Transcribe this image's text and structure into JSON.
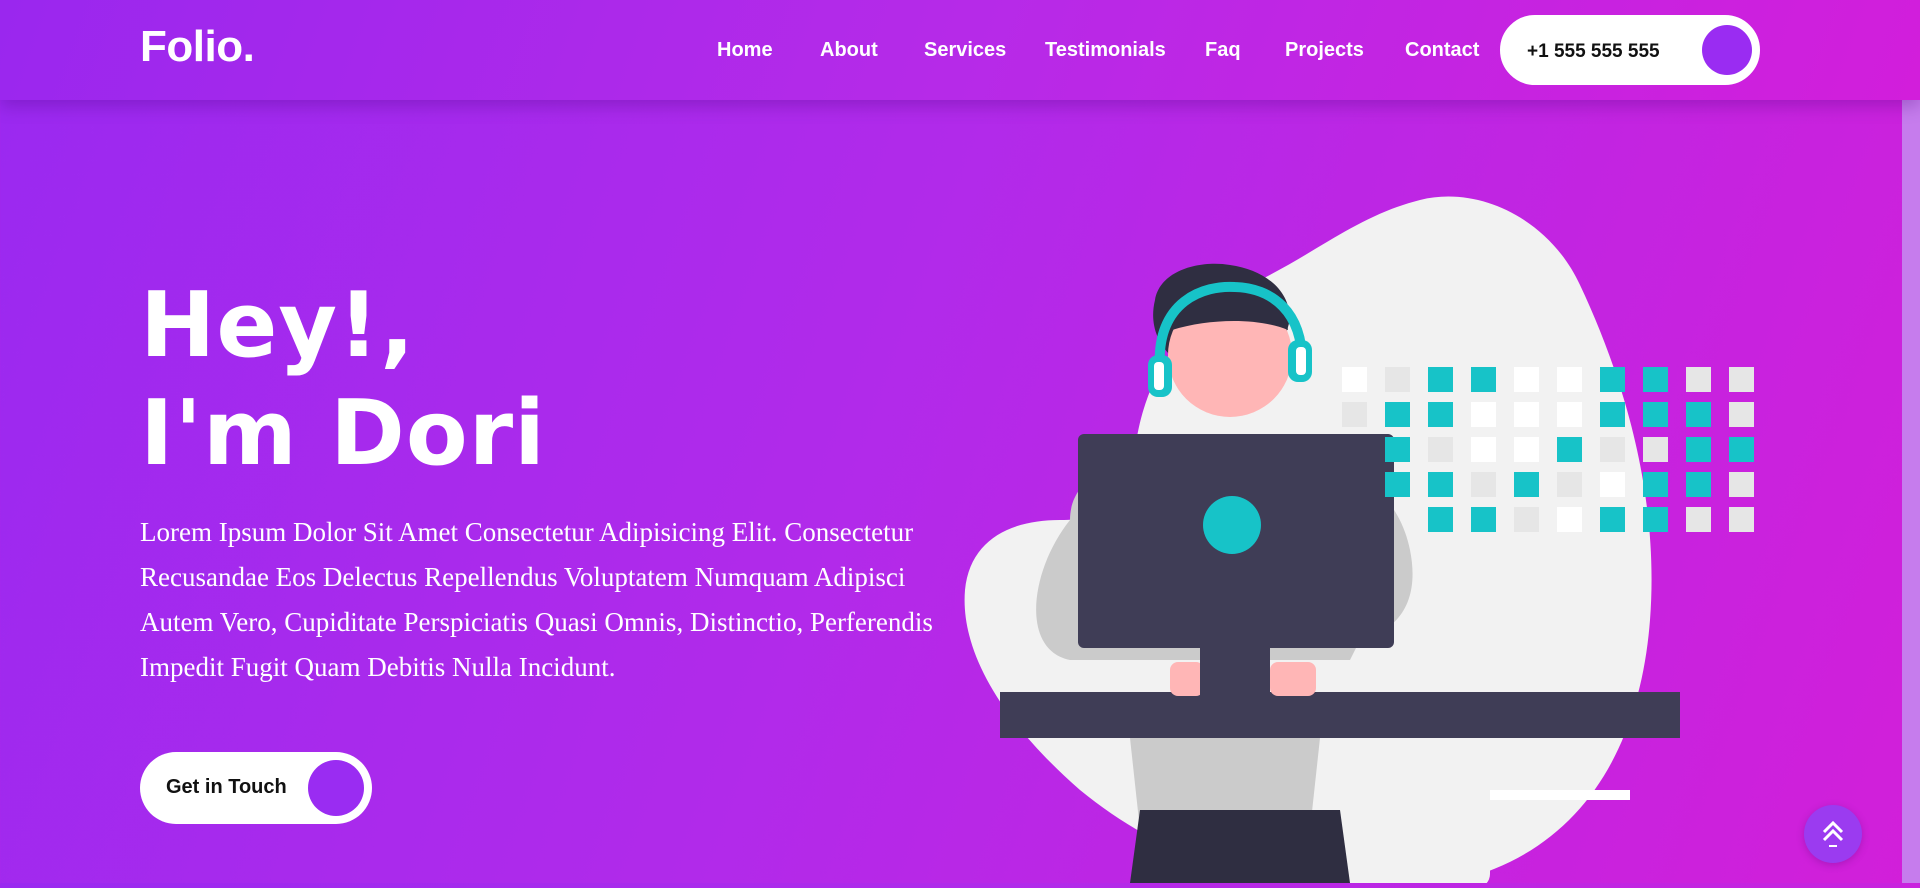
{
  "header": {
    "logo": "Folio.",
    "nav": [
      "Home",
      "About",
      "Services",
      "Testimonials",
      "Faq",
      "Projects",
      "Contact"
    ],
    "phone": "+1 555 555 555"
  },
  "hero": {
    "title_line1": "Hey!,",
    "title_line2": "I'm Dori",
    "description": "Lorem Ipsum Dolor Sit Amet Consectetur Adipisicing Elit. Consectetur Recusandae Eos Delectus Repellendus Voluptatem Numquam Adipisci Autem Vero, Cupiditate Perspiciatis Quasi Omnis, Distinctio, Perferendis Impedit Fugit Quam Debitis Nulla Incidunt.",
    "cta_label": "Get in Touch"
  },
  "icons": {
    "phone_button_dot": "circle",
    "cta_dot": "circle",
    "scroll_top": "double-arrow-up-icon"
  },
  "colors": {
    "background_start": "#9a29f0",
    "background_end": "#d21fd9",
    "accent_purple": "#9a2cf2",
    "accent_teal": "#17c3c8",
    "monitor": "#3f3d56",
    "white": "#ffffff"
  }
}
